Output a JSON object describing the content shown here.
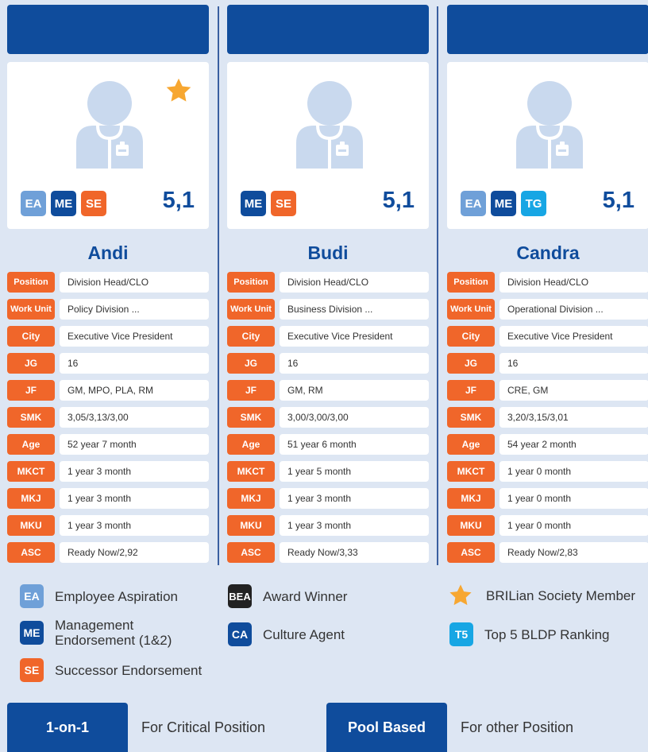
{
  "colors": {
    "brand_blue": "#0f4c9c",
    "accent_orange": "#f0662a",
    "light_blue": "#6fa0d8",
    "cyan": "#17a6e4",
    "background": "#dde6f3",
    "star": "#f7a731"
  },
  "candidates": [
    {
      "name": "Andi",
      "score": "5,1",
      "star": true,
      "badges": [
        "EA",
        "ME",
        "SE"
      ],
      "rows": [
        {
          "label": "Position",
          "value": "Division Head/CLO"
        },
        {
          "label": "Work Unit",
          "value": "Policy Division ..."
        },
        {
          "label": "City",
          "value": "Executive Vice President"
        },
        {
          "label": "JG",
          "value": "16"
        },
        {
          "label": "JF",
          "value": "GM, MPO, PLA, RM"
        },
        {
          "label": "SMK",
          "value": "3,05/3,13/3,00"
        },
        {
          "label": "Age",
          "value": "52 year 7 month"
        },
        {
          "label": "MKCT",
          "value": "1 year 3 month"
        },
        {
          "label": "MKJ",
          "value": "1 year 3 month"
        },
        {
          "label": "MKU",
          "value": "1 year 3 month"
        },
        {
          "label": "ASC",
          "value": "Ready Now/2,92"
        }
      ]
    },
    {
      "name": "Budi",
      "score": "5,1",
      "star": false,
      "badges": [
        "ME",
        "SE"
      ],
      "rows": [
        {
          "label": "Position",
          "value": "Division Head/CLO"
        },
        {
          "label": "Work Unit",
          "value": "Business Division ..."
        },
        {
          "label": "City",
          "value": "Executive Vice President"
        },
        {
          "label": "JG",
          "value": "16"
        },
        {
          "label": "JF",
          "value": "GM, RM"
        },
        {
          "label": "SMK",
          "value": "3,00/3,00/3,00"
        },
        {
          "label": "Age",
          "value": "51 year 6 month"
        },
        {
          "label": "MKCT",
          "value": "1 year 5 month"
        },
        {
          "label": "MKJ",
          "value": "1 year 3 month"
        },
        {
          "label": "MKU",
          "value": "1 year 3 month"
        },
        {
          "label": "ASC",
          "value": "Ready Now/3,33"
        }
      ]
    },
    {
      "name": "Candra",
      "score": "5,1",
      "star": false,
      "badges": [
        "EA",
        "ME",
        "TG"
      ],
      "rows": [
        {
          "label": "Position",
          "value": "Division Head/CLO"
        },
        {
          "label": "Work Unit",
          "value": "Operational Division ..."
        },
        {
          "label": "City",
          "value": "Executive Vice President"
        },
        {
          "label": "JG",
          "value": "16"
        },
        {
          "label": "JF",
          "value": "CRE, GM"
        },
        {
          "label": "SMK",
          "value": "3,20/3,15/3,01"
        },
        {
          "label": "Age",
          "value": "54 year 2 month"
        },
        {
          "label": "MKCT",
          "value": "1 year 0 month"
        },
        {
          "label": "MKJ",
          "value": "1 year 0 month"
        },
        {
          "label": "MKU",
          "value": "1 year 0 month"
        },
        {
          "label": "ASC",
          "value": "Ready Now/2,83"
        }
      ]
    }
  ],
  "legend": {
    "ea": {
      "badge": "EA",
      "text": "Employee Aspiration"
    },
    "me": {
      "badge": "ME",
      "text": "Management Endorsement (1&2)"
    },
    "se": {
      "badge": "SE",
      "text": "Successor Endorsement"
    },
    "bea": {
      "badge": "BEA",
      "text": "Award Winner"
    },
    "ca": {
      "badge": "CA",
      "text": "Culture Agent"
    },
    "star": {
      "icon": "star-icon",
      "text": "BRILian Society Member"
    },
    "t5": {
      "badge": "T5",
      "text": "Top 5 BLDP Ranking"
    }
  },
  "footer": {
    "one_on_one_label": "1-on-1",
    "one_on_one_text": "For Critical Position",
    "pool_label": "Pool Based",
    "pool_text": "For other Position"
  }
}
